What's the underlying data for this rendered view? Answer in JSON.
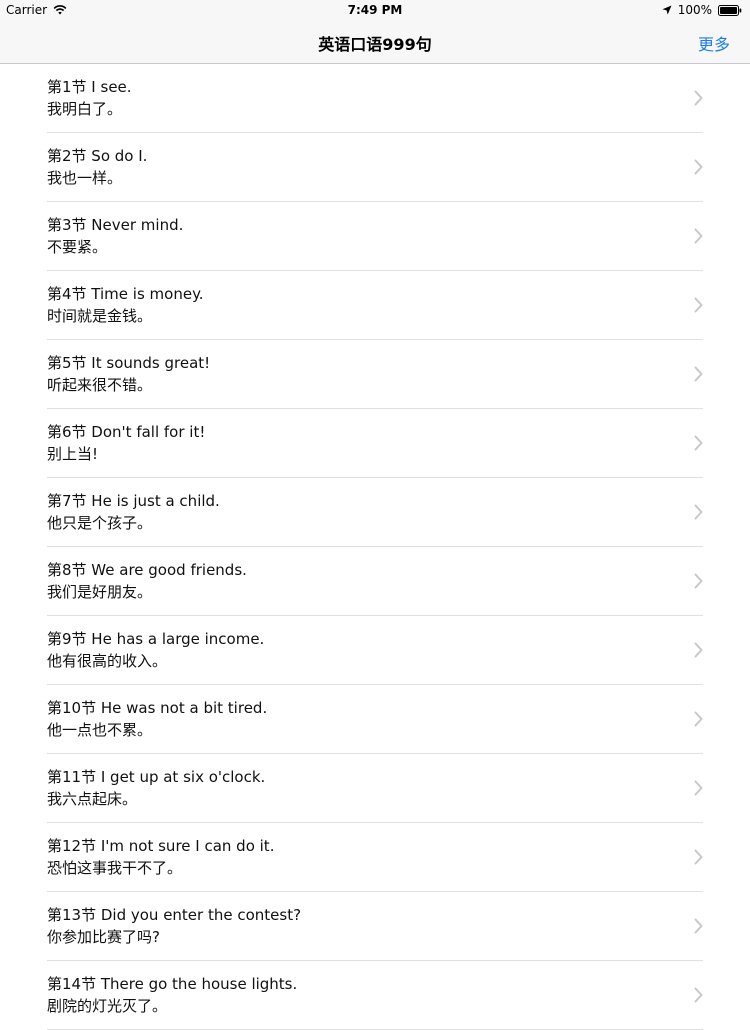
{
  "status_bar": {
    "carrier": "Carrier",
    "time": "7:49 PM",
    "battery": "100%"
  },
  "nav": {
    "title": "英语口语999句",
    "more_label": "更多"
  },
  "lessons": [
    {
      "title": "第1节 I see.",
      "subtitle": "我明白了。"
    },
    {
      "title": "第2节 So do I.",
      "subtitle": "我也一样。"
    },
    {
      "title": "第3节 Never mind.",
      "subtitle": "不要紧。"
    },
    {
      "title": "第4节 Time is money.",
      "subtitle": "时间就是金钱。"
    },
    {
      "title": "第5节 It sounds great!",
      "subtitle": "听起来很不错。"
    },
    {
      "title": "第6节 Don't fall for it!",
      "subtitle": "别上当!"
    },
    {
      "title": "第7节 He is just a child.",
      "subtitle": "他只是个孩子。"
    },
    {
      "title": "第8节 We are good friends.",
      "subtitle": "我们是好朋友。"
    },
    {
      "title": "第9节 He has a large income.",
      "subtitle": "他有很高的收入。"
    },
    {
      "title": "第10节 He was not a bit tired.",
      "subtitle": "他一点也不累。"
    },
    {
      "title": "第11节 I get up at six o'clock.",
      "subtitle": "我六点起床。"
    },
    {
      "title": "第12节 I'm not sure I can do it.",
      "subtitle": "恐怕这事我干不了。"
    },
    {
      "title": "第13节 Did you enter the contest?",
      "subtitle": "你参加比赛了吗?"
    },
    {
      "title": "第14节 There go the house lights.",
      "subtitle": "剧院的灯光灭了。"
    }
  ],
  "colors": {
    "accent": "#1a7cf4",
    "nav_background": "#f7f7f7",
    "separator": "#e0e0e0",
    "chevron": "#c7c7cc"
  },
  "icons": {
    "wifi": "wifi-icon",
    "location": "location-arrow-icon",
    "battery": "battery-icon",
    "row_disclosure": "chevron-right-icon"
  }
}
